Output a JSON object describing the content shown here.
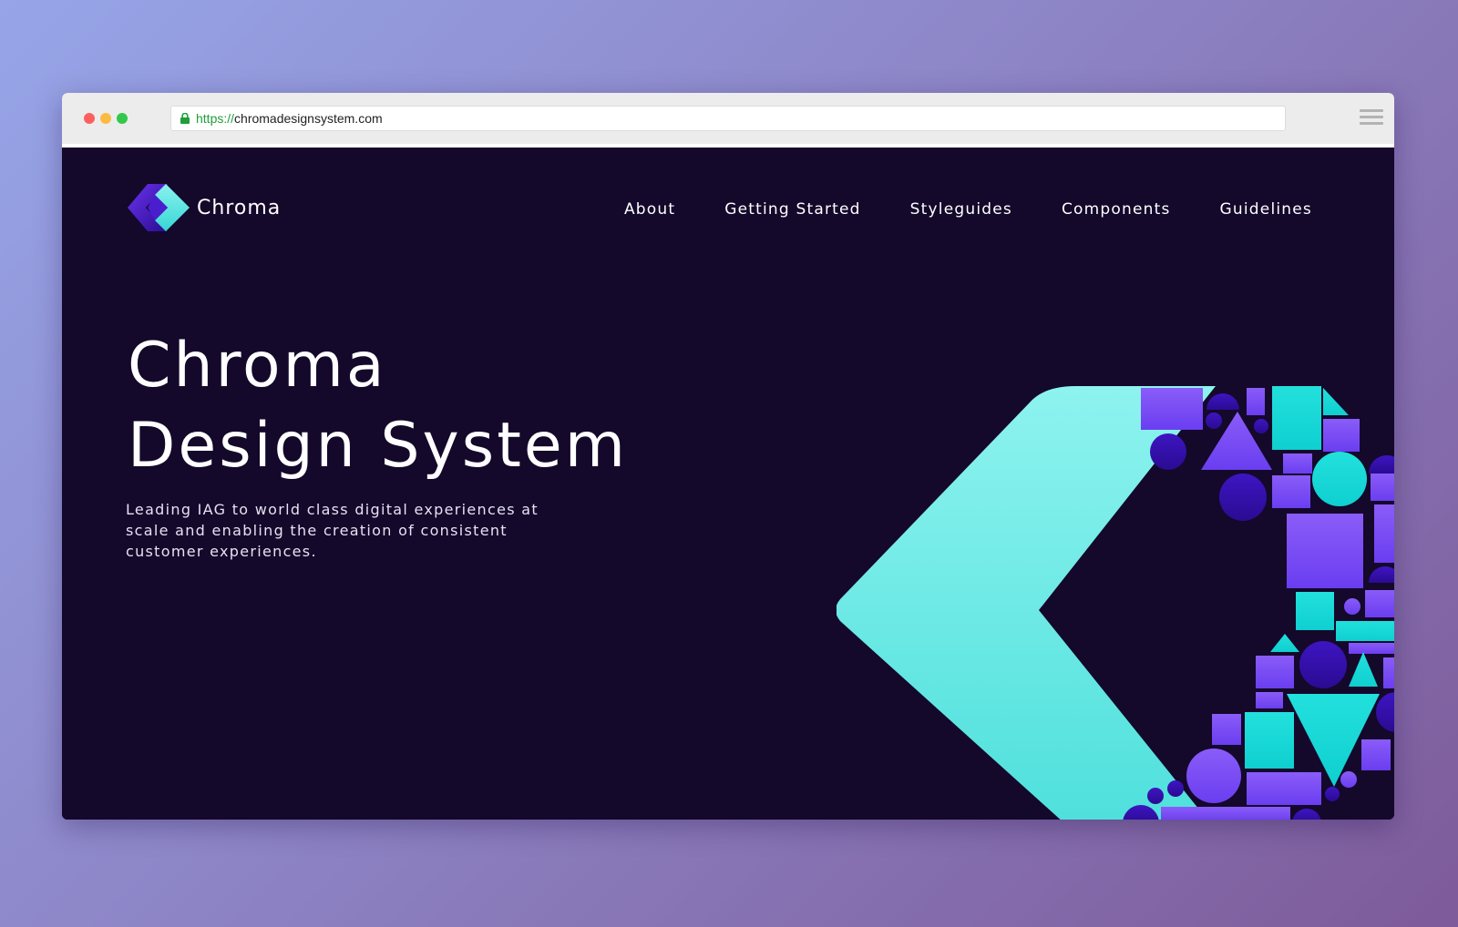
{
  "browser": {
    "url_scheme": "https://",
    "url_host": "chromadesignsystem.com"
  },
  "brand": {
    "name": "Chroma"
  },
  "nav": {
    "items": [
      "About",
      "Getting Started",
      "Styleguides",
      "Components",
      "Guidelines"
    ]
  },
  "hero": {
    "title_line1": "Chroma",
    "title_line2": "Design System",
    "subtitle": "Leading IAG to world class digital experiences at scale and enabling the creation of consistent customer experiences."
  },
  "colors": {
    "background": "#14082b",
    "teal": "#5ce8e4",
    "purple": "#7b4cf5",
    "deep_purple": "#3a12b8"
  }
}
